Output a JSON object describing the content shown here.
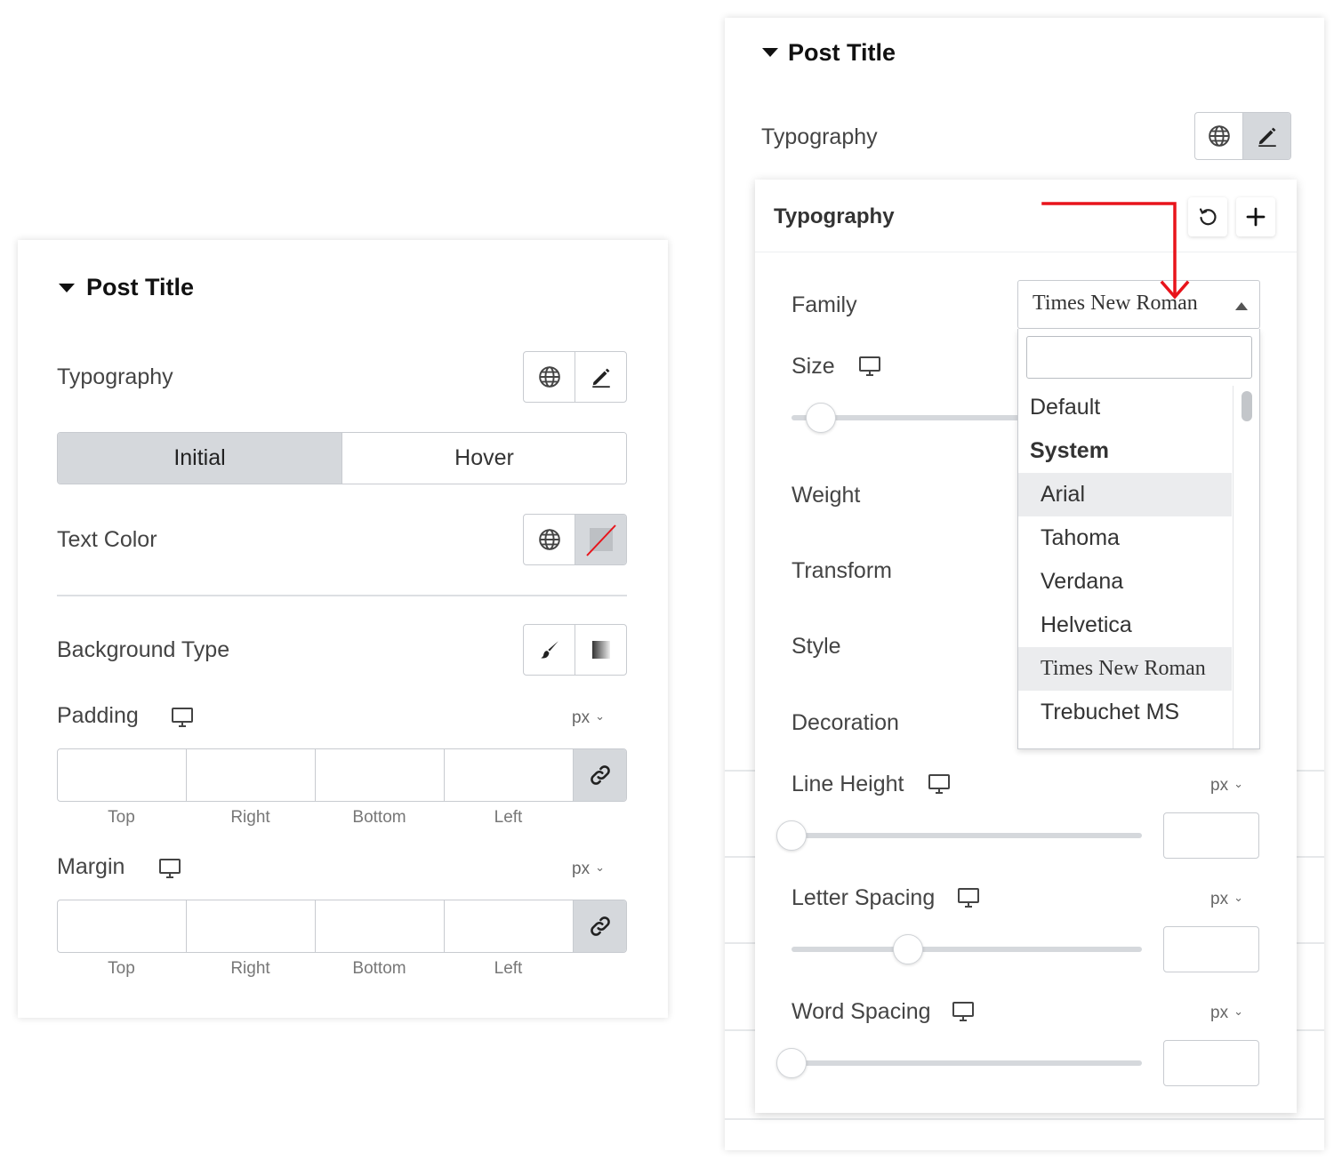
{
  "left_panel": {
    "section_title": "Post Title",
    "typography_label": "Typography",
    "tabs": [
      "Initial",
      "Hover"
    ],
    "text_color_label": "Text Color",
    "background_type_label": "Background Type",
    "padding": {
      "label": "Padding",
      "unit": "px",
      "sides": [
        "Top",
        "Right",
        "Bottom",
        "Left"
      ]
    },
    "margin": {
      "label": "Margin",
      "unit": "px",
      "sides": [
        "Top",
        "Right",
        "Bottom",
        "Left"
      ]
    }
  },
  "right_panel": {
    "section_title": "Post Title",
    "typography_label": "Typography",
    "popup": {
      "title": "Typography",
      "family_label": "Family",
      "family_value": "Times New Roman",
      "size_label": "Size",
      "weight_label": "Weight",
      "transform_label": "Transform",
      "style_label": "Style",
      "decoration_label": "Decoration",
      "line_height_label": "Line Height",
      "line_height_unit": "px",
      "letter_spacing_label": "Letter Spacing",
      "letter_spacing_unit": "px",
      "word_spacing_label": "Word Spacing",
      "word_spacing_unit": "px"
    },
    "dropdown": {
      "search_value": "",
      "items": [
        {
          "label": "Default",
          "kind": "option"
        },
        {
          "label": "System",
          "kind": "group"
        },
        {
          "label": "Arial",
          "kind": "option",
          "hovered": true
        },
        {
          "label": "Tahoma",
          "kind": "option"
        },
        {
          "label": "Verdana",
          "kind": "option"
        },
        {
          "label": "Helvetica",
          "kind": "option"
        },
        {
          "label": "Times New Roman",
          "kind": "option",
          "selected": true
        },
        {
          "label": "Trebuchet MS",
          "kind": "option"
        }
      ]
    }
  },
  "colors": {
    "annotation_arrow": "#e8141b",
    "active_segment": "#d5d8dc",
    "border": "#c8cbd0"
  },
  "icons": [
    "caret-down-icon",
    "globe-icon",
    "pencil-icon",
    "no-color-icon",
    "brush-icon",
    "gradient-icon",
    "desktop-icon",
    "link-icon",
    "reset-icon",
    "plus-icon",
    "caret-up-icon",
    "chevron-down-icon"
  ]
}
